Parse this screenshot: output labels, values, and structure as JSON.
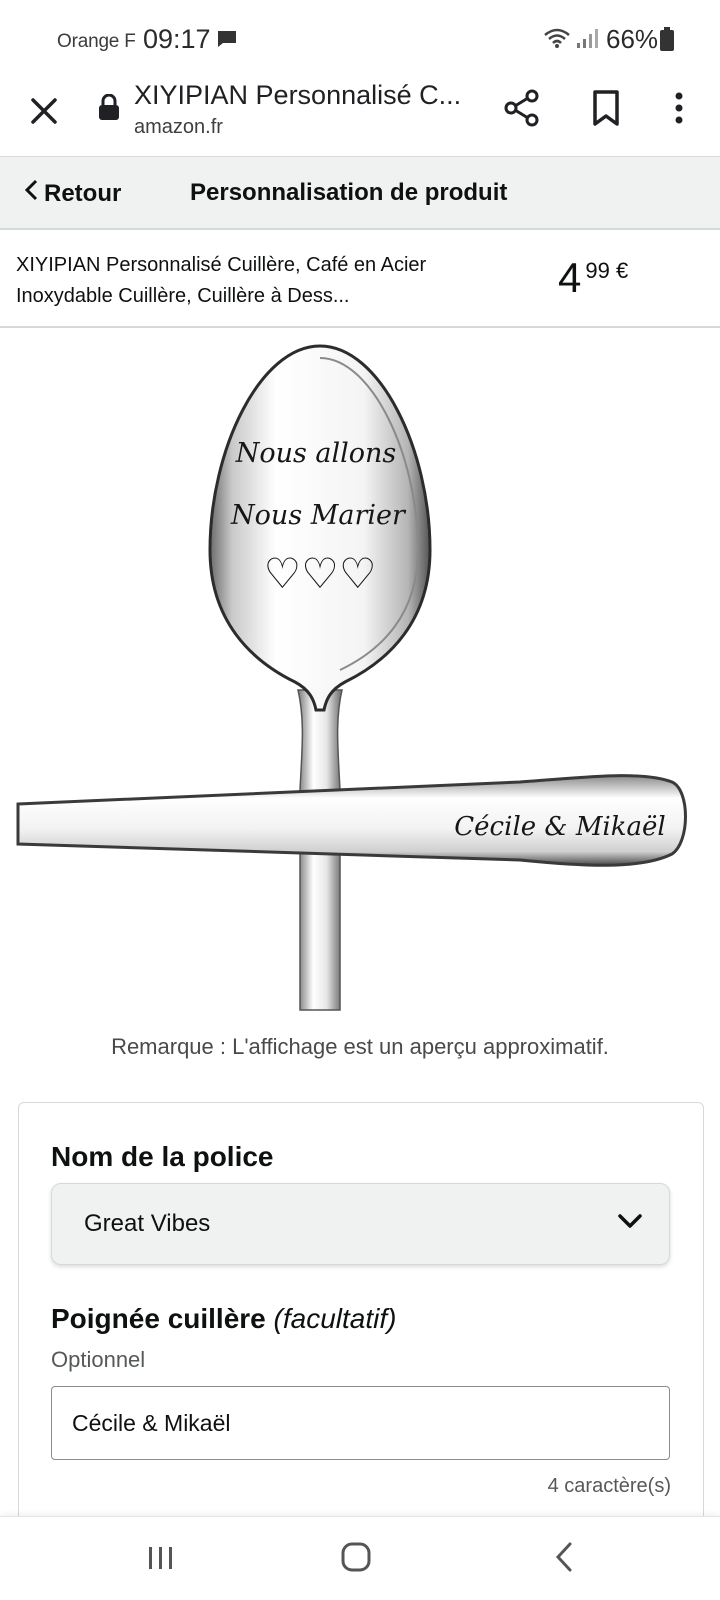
{
  "status_bar": {
    "carrier": "Orange F",
    "time": "09:17",
    "battery": "66%"
  },
  "browser": {
    "title": "XIYIPIAN Personnalisé C...",
    "domain": "amazon.fr"
  },
  "header": {
    "back_label": "Retour",
    "title": "Personnalisation de produit"
  },
  "product": {
    "name": "XIYIPIAN Personnalisé Cuillère, Café en Acier Inoxydable Cuillère, Cuillère à Dess...",
    "price_whole": "4",
    "price_fraction": "99 €"
  },
  "preview": {
    "engraving_line1": "Nous allons",
    "engraving_line2": "Nous Marier",
    "hearts": "♡♡♡",
    "handle_text": "Cécile & Mikaël",
    "remark": "Remarque : L'affichage est un aperçu approximatif."
  },
  "form": {
    "font_label": "Nom de la police",
    "font_value": "Great Vibes",
    "handle_label": "Poignée cuillère",
    "handle_optional": "(facultatif)",
    "handle_hint": "Optionnel",
    "handle_value": "Cécile & Mikaël",
    "char_count": "4 caractère(s)"
  },
  "icons": {
    "close": "close-icon",
    "lock": "lock-icon",
    "share": "share-icon",
    "bookmark": "bookmark-icon",
    "more": "more-vertical-icon",
    "back": "chevron-left-icon",
    "dropdown": "chevron-down-icon"
  },
  "colors": {
    "header_bg": "#f0f2f2",
    "border": "#d5d9d9",
    "text": "#0f1111",
    "muted": "#565959"
  }
}
